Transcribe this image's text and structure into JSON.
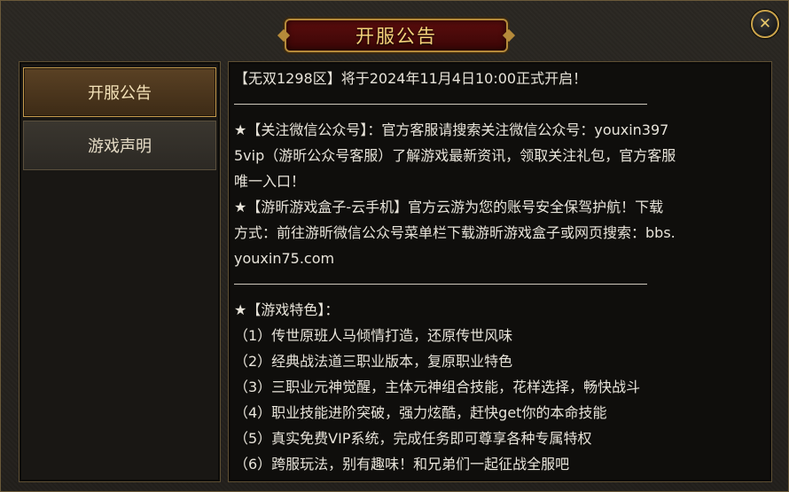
{
  "title": "开服公告",
  "tabs": [
    {
      "label": "开服公告",
      "active": true
    },
    {
      "label": "游戏声明",
      "active": false
    }
  ],
  "content": {
    "headline": "【无双1298区】将于2024年11月4日10:00正式开启！",
    "wechat_lines": [
      "★【关注微信公众号】：官方客服请搜索关注微信公众号：youxin397",
      "5vip（游昕公众号客服）了解游戏最新资讯，领取关注礼包，官方客服",
      "唯一入口！"
    ],
    "box_lines": [
      "★【游昕游戏盒子-云手机】官方云游为您的账号安全保驾护航！下载",
      "方式：前往游昕微信公众号菜单栏下载游昕游戏盒子或网页搜索：bbs.",
      "youxin75.com"
    ],
    "features_title": "★【游戏特色】：",
    "features": [
      "（1）传世原班人马倾情打造，还原传世风味",
      "（2）经典战法道三职业版本，复原职业特色",
      "（3）三职业元神觉醒，主体元神组合技能，花样选择，畅快战斗",
      "（4）职业技能进阶突破，强力炫酷，赶快get你的本命技能",
      "（5）真实免费VIP系统，完成任务即可尊享各种专属特权",
      "（6）跨服玩法，别有趣味！和兄弟们一起征战全服吧"
    ]
  },
  "close_icon": "close-icon",
  "colors": {
    "title_text": "#f3d27a",
    "body_text": "#e8e4da",
    "border_gold": "#c79c4e"
  }
}
